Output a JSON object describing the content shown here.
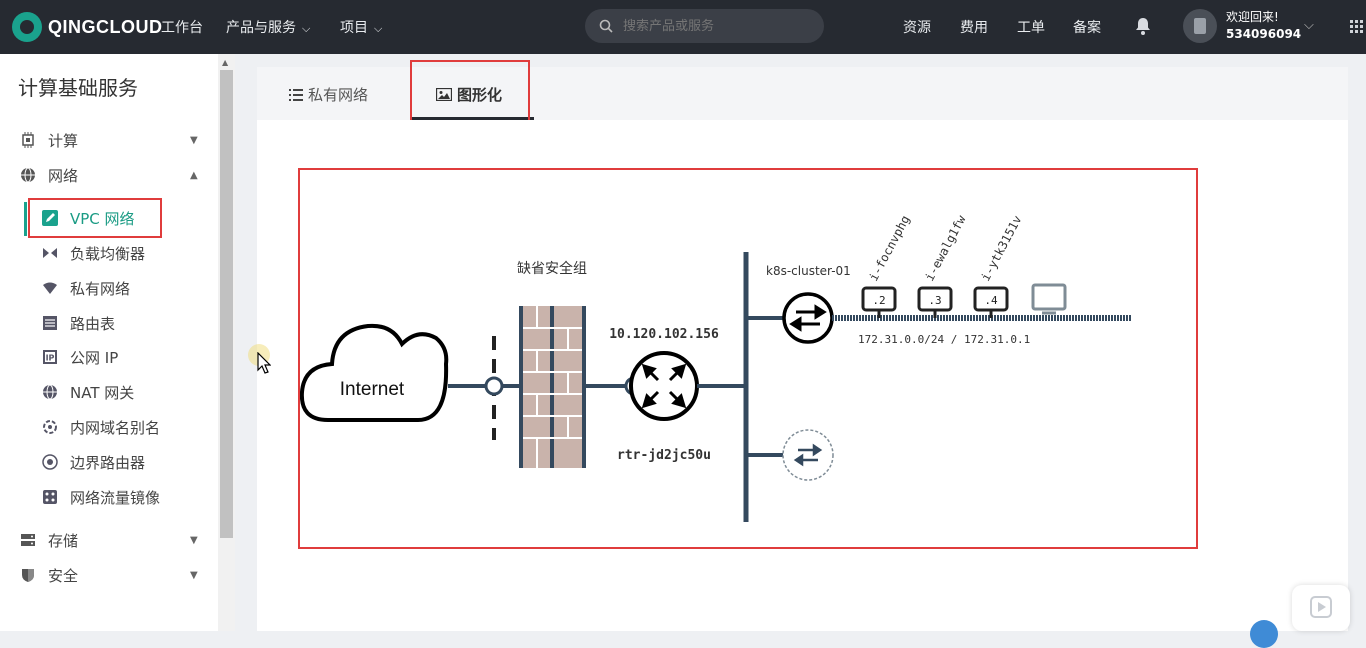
{
  "topbar": {
    "logo_text": "QINGCLOUD",
    "nav": [
      {
        "label": "工作台"
      },
      {
        "label": "产品与服务"
      },
      {
        "label": "项目"
      }
    ],
    "search_placeholder": "搜索产品或服务",
    "links": [
      "资源",
      "费用",
      "工单",
      "备案"
    ],
    "welcome": "欢迎回来!",
    "user_id": "534096094"
  },
  "sidebar": {
    "title": "计算基础服务",
    "groups": [
      {
        "label": "计算",
        "icon": "cpu-icon",
        "expanded": false
      },
      {
        "label": "网络",
        "icon": "network-icon",
        "expanded": true
      },
      {
        "label": "存储",
        "icon": "storage-icon",
        "expanded": false
      },
      {
        "label": "安全",
        "icon": "shield-icon",
        "expanded": false
      }
    ],
    "network_items": [
      {
        "label": "VPC 网络",
        "icon": "vpc-icon",
        "active": true
      },
      {
        "label": "负载均衡器",
        "icon": "load-balancer-icon"
      },
      {
        "label": "私有网络",
        "icon": "private-network-icon"
      },
      {
        "label": "路由表",
        "icon": "route-table-icon"
      },
      {
        "label": "公网 IP",
        "icon": "public-ip-icon"
      },
      {
        "label": "NAT 网关",
        "icon": "nat-gateway-icon"
      },
      {
        "label": "内网域名别名",
        "icon": "dns-alias-icon"
      },
      {
        "label": "边界路由器",
        "icon": "border-router-icon"
      },
      {
        "label": "网络流量镜像",
        "icon": "traffic-mirror-icon"
      }
    ]
  },
  "tabs": [
    {
      "label": "私有网络",
      "icon": "list-icon"
    },
    {
      "label": "图形化",
      "icon": "image-icon",
      "active": true
    }
  ],
  "diagram": {
    "internet_label": "Internet",
    "security_group_label": "缺省安全组",
    "router_ip": "10.120.102.156",
    "router_id": "rtr-jd2jc50u",
    "cluster_label": "k8s-cluster-01",
    "subnet_label": "172.31.0.0/24 / 172.31.0.1",
    "hosts": [
      {
        "name": "i-focnvphg",
        "ip_suffix": ".2"
      },
      {
        "name": "i-ewalg1fw",
        "ip_suffix": ".3"
      },
      {
        "name": "i-ytk3151v",
        "ip_suffix": ".4"
      }
    ]
  },
  "colors": {
    "topbar_bg": "#262a31",
    "accent": "#1aa28d",
    "highlight": "#e03c3c",
    "diagram_line": "#34495e"
  }
}
